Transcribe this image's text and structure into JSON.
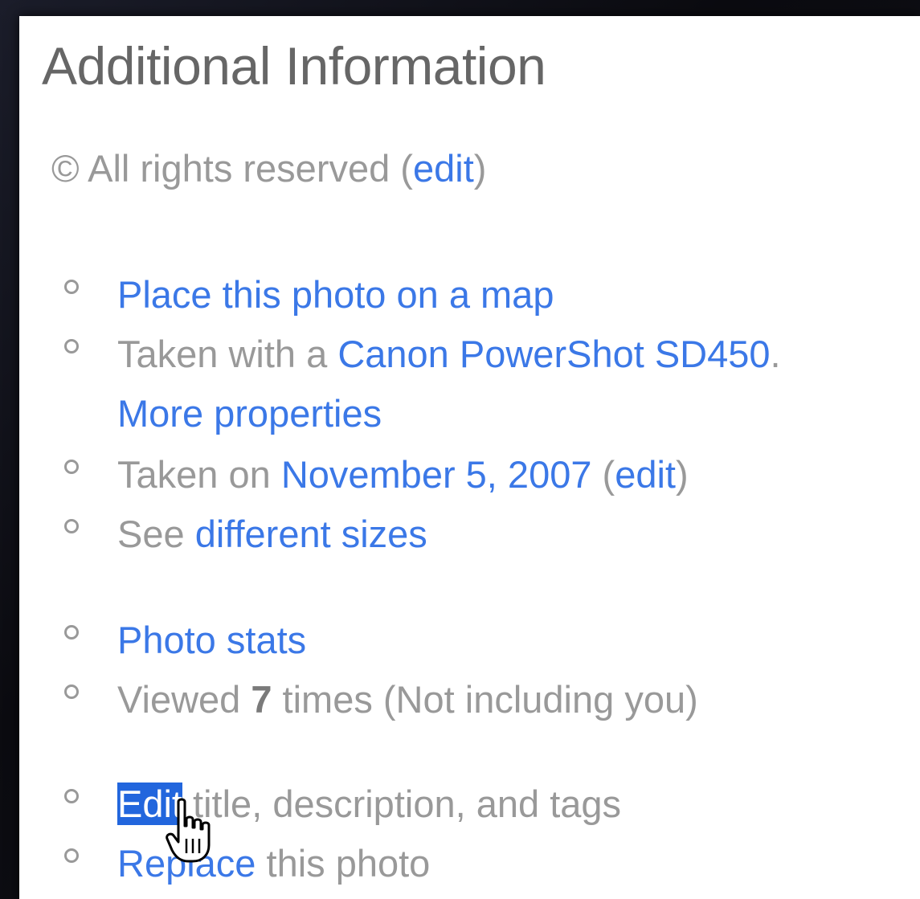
{
  "panel": {
    "title": "Additional Information"
  },
  "license": {
    "symbol": "©",
    "text": "All rights reserved",
    "open_paren": " (",
    "edit_label": "edit",
    "close_paren": ")"
  },
  "items": [
    {
      "link": "Place this photo on a map"
    },
    {
      "prefix": "Taken with a ",
      "camera_link": "Canon PowerShot SD450",
      "suffix": ".",
      "more_link": "More properties"
    },
    {
      "prefix": "Taken on ",
      "date_link": "November 5, 2007",
      "open_paren": " (",
      "edit_label": "edit",
      "close_paren": ")"
    },
    {
      "prefix": "See ",
      "sizes_link": "different sizes"
    },
    {
      "link": "Photo stats"
    },
    {
      "prefix": "Viewed ",
      "count": "7",
      "suffix": " times  (Not including you)"
    },
    {
      "link_selected": "Edit",
      "suffix": " title, description, and tags"
    },
    {
      "link": "Replace",
      "suffix": " this photo"
    }
  ],
  "icons": {
    "bullet": "circle-bullet-icon",
    "cursor": "hand-pointer-icon"
  },
  "colors": {
    "link": "#3b78e7",
    "text": "#999999",
    "title": "#666666",
    "selection": "#2266dd"
  }
}
